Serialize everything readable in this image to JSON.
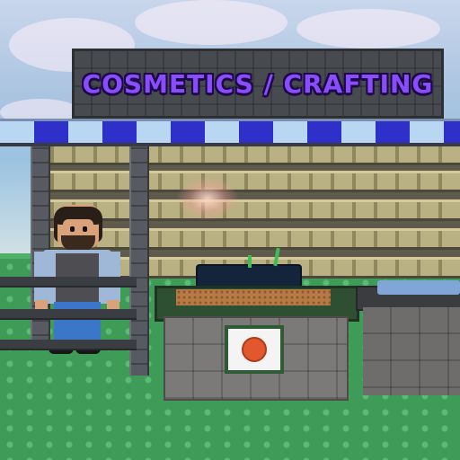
{
  "sign": {
    "title": "COSMETICS / CRAFTING",
    "title_color": "#8a4cff"
  },
  "scene": {
    "awning_colors": [
      "#b9d7f2",
      "#2f2fc9"
    ],
    "ground_color": "#3e9c58",
    "sky_color": "#aac4e0"
  },
  "npc": {
    "name": "shopkeeper-npc",
    "shirt_color": "#9fb8d8",
    "pants_color": "#3b76c9"
  },
  "crafting_table": {
    "emblem_icon": "orange-circle-icon",
    "emblem_color": "#e0582c"
  }
}
